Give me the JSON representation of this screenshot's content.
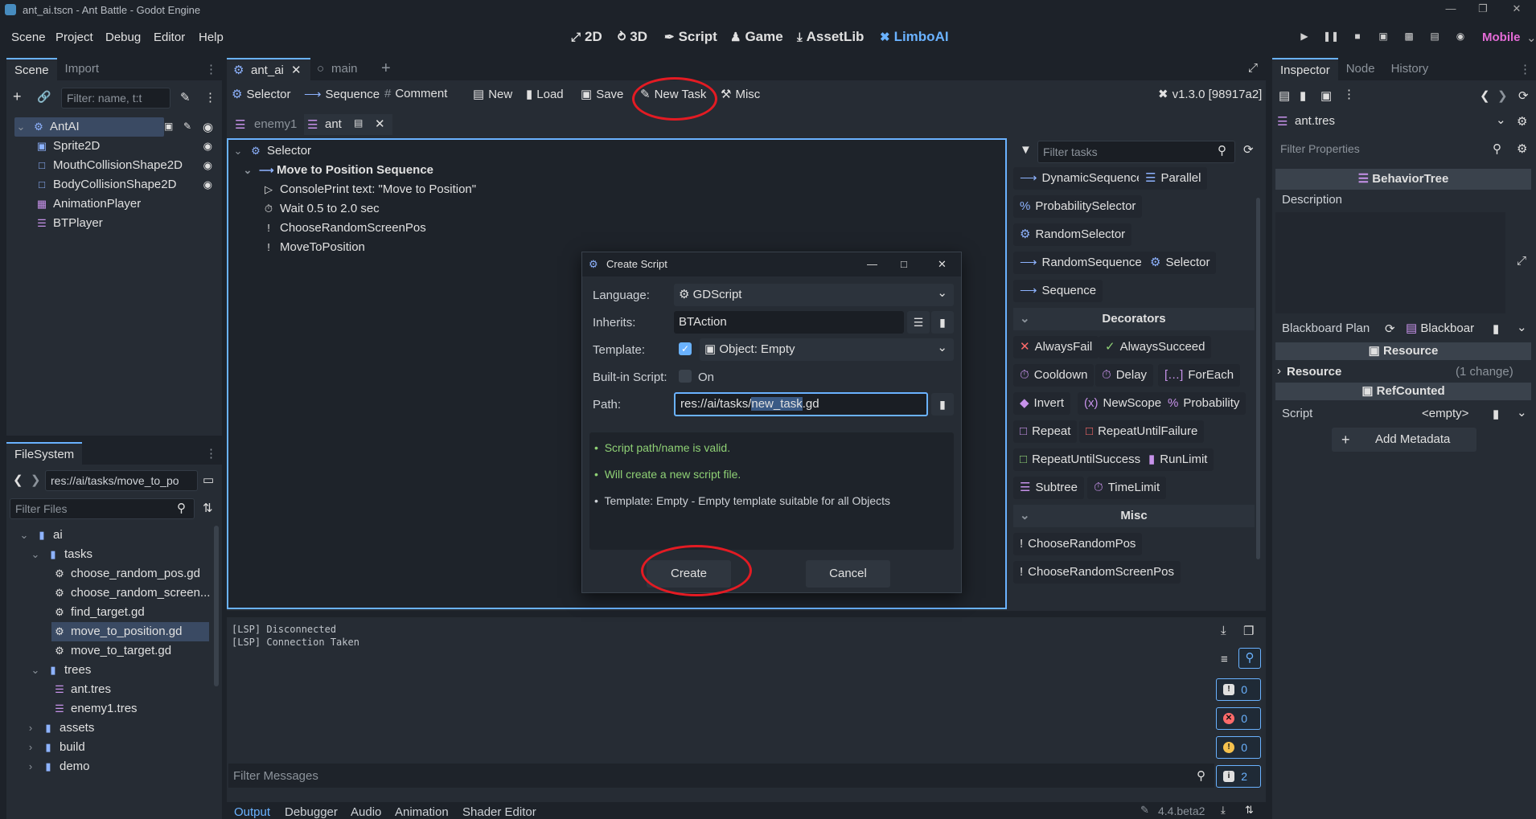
{
  "window": {
    "title": "ant_ai.tscn - Ant Battle - Godot Engine"
  },
  "menu": [
    "Scene",
    "Project",
    "Debug",
    "Editor",
    "Help"
  ],
  "workspaces": [
    {
      "icon": "2d-icon",
      "label": "2D"
    },
    {
      "icon": "3d-icon",
      "label": "3D"
    },
    {
      "icon": "script-icon",
      "label": "Script"
    },
    {
      "icon": "game-icon",
      "label": "Game"
    },
    {
      "icon": "assetlib-icon",
      "label": "AssetLib"
    },
    {
      "icon": "limboai-icon",
      "label": "LimboAI"
    }
  ],
  "renderer": "Mobile",
  "scene_dock": {
    "tabs": [
      "Scene",
      "Import"
    ],
    "filter_placeholder": "Filter: name, t:t",
    "nodes": [
      "AntAI",
      "Sprite2D",
      "MouthCollisionShape2D",
      "BodyCollisionShape2D",
      "AnimationPlayer",
      "BTPlayer"
    ]
  },
  "filesystem": {
    "tab": "FileSystem",
    "path": "res://ai/tasks/move_to_po",
    "filter_placeholder": "Filter Files",
    "items": [
      "ai",
      "tasks",
      "choose_random_pos.gd",
      "choose_random_screen...",
      "find_target.gd",
      "move_to_position.gd",
      "move_to_target.gd",
      "trees",
      "ant.tres",
      "enemy1.tres",
      "assets",
      "build",
      "demo"
    ]
  },
  "editor_tabs": [
    "ant_ai",
    "main"
  ],
  "bt_toolbar": [
    "Selector",
    "Sequence",
    "Comment",
    "New",
    "Load",
    "Save",
    "New Task",
    "Misc"
  ],
  "version": "v1.3.0 [98917a2]",
  "bt_tabs": [
    "enemy1",
    "ant"
  ],
  "bt_tree": [
    "Selector",
    "Move to Position Sequence",
    "ConsolePrint  text: \"Move to Position\"",
    "Wait 0.5 to 2.0 sec",
    "ChooseRandomScreenPos",
    "MoveToPosition"
  ],
  "task_palette": {
    "filter_placeholder": "Filter tasks",
    "composites": [
      "DynamicSequence",
      "Parallel",
      "ProbabilitySelector",
      "RandomSelector",
      "RandomSequence",
      "Selector",
      "Sequence"
    ],
    "decorators_title": "Decorators",
    "decorators": [
      "AlwaysFail",
      "AlwaysSucceed",
      "Cooldown",
      "Delay",
      "ForEach",
      "Invert",
      "NewScope",
      "Probability",
      "Repeat",
      "RepeatUntilFailure",
      "RepeatUntilSuccess",
      "RunLimit",
      "Subtree",
      "TimeLimit"
    ],
    "misc_title": "Misc",
    "misc": [
      "ChooseRandomPos",
      "ChooseRandomScreenPos"
    ]
  },
  "dialog": {
    "title": "Create Script",
    "language_label": "Language:",
    "language": "GDScript",
    "inherits_label": "Inherits:",
    "inherits": "BTAction",
    "template_label": "Template:",
    "template": "Object: Empty",
    "builtin_label": "Built-in Script:",
    "builtin": "On",
    "path_label": "Path:",
    "path_prefix": "res://ai/tasks/",
    "path_selected": "new_task",
    "path_suffix": ".gd",
    "messages": [
      "Script path/name is valid.",
      "Will create a new script file.",
      "Template: Empty - Empty template suitable for all Objects"
    ],
    "create": "Create",
    "cancel": "Cancel"
  },
  "output": {
    "lines": [
      "[LSP] Disconnected",
      "[LSP] Connection Taken"
    ],
    "filter_placeholder": "Filter Messages",
    "counts": [
      "0",
      "0",
      "0",
      "2"
    ],
    "bottom_tabs": [
      "Output",
      "Debugger",
      "Audio",
      "Animation",
      "Shader Editor"
    ],
    "engine_version": "4.4.beta2"
  },
  "inspector": {
    "tabs": [
      "Inspector",
      "Node",
      "History"
    ],
    "resource": "ant.tres",
    "filter_placeholder": "Filter Properties",
    "class": "BehaviorTree",
    "description_label": "Description",
    "blackboard_label": "Blackboard Plan",
    "blackboard_value": "Blackboar",
    "resource_section": "Resource",
    "resource_sub": "Resource",
    "resource_changes": "(1 change)",
    "refcounted": "RefCounted",
    "script_label": "Script",
    "script_value": "<empty>",
    "add_metadata": "Add Metadata"
  },
  "colors": {
    "accent": "#6ab2ff",
    "highlight_ring": "#e31b23",
    "valid": "#8fd175"
  }
}
